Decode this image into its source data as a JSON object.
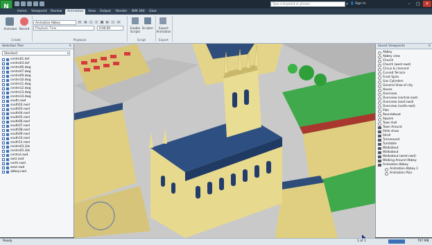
{
  "app": {
    "logo_letter": "N"
  },
  "search": {
    "placeholder": "Type a keyword or phrase"
  },
  "account": {
    "signin": "Sign In"
  },
  "tabs": [
    {
      "label": "Home"
    },
    {
      "label": "Viewpoint"
    },
    {
      "label": "Review"
    },
    {
      "label": "Animation"
    },
    {
      "label": "View"
    },
    {
      "label": "Output"
    },
    {
      "label": "Render"
    },
    {
      "label": "BIM 360"
    },
    {
      "label": "Glue"
    }
  ],
  "ribbon": {
    "create": {
      "animator_label": "Animator",
      "record_label": "Record",
      "group": "Create"
    },
    "playback": {
      "animation_select": "Animation-Abbey",
      "time_value": "0:00.00",
      "playback_time_field": "Playback Time",
      "group": "Playback"
    },
    "script": {
      "enable_label": "Enable Scripts",
      "scripter_label": "Scripter",
      "group": "Script"
    },
    "export": {
      "export_label": "Export Animation",
      "group": "Export"
    }
  },
  "selection_tree": {
    "title": "Selection Tree",
    "dropdown": "Standard",
    "items": [
      "centre01.dxf",
      "centre03.dxf",
      "centre06.dwg",
      "centre07.dwg",
      "centre09.dwg",
      "centre10.dwg",
      "centre11.dwg",
      "centre12.dwg",
      "centre13.dwg",
      "centre14.dwg",
      "south.nwd",
      "south02.nwd",
      "south03.nwd",
      "south04.nwd",
      "south05.nwd",
      "south06.nwd",
      "south07.nwd",
      "south08.nwd",
      "south09.nwd",
      "south10.nwd",
      "south12.nwd",
      "centre03.3ds",
      "centre05.3ds",
      "central.nwd",
      "east.nwd",
      "north.nwd",
      "west.nwd",
      "abbey.nwd"
    ]
  },
  "saved_viewpoints": {
    "title": "Saved Viewpoints",
    "items": [
      {
        "label": "Abbey",
        "kind": "vp"
      },
      {
        "label": "Abbey view",
        "kind": "vp"
      },
      {
        "label": "Church",
        "kind": "vp"
      },
      {
        "label": "Church (west.nwd)",
        "kind": "vp"
      },
      {
        "label": "Circus & crescent",
        "kind": "vp"
      },
      {
        "label": "Curved Terrace",
        "kind": "vp"
      },
      {
        "label": "Front Spire",
        "kind": "vp"
      },
      {
        "label": "Gas Cylinders",
        "kind": "vp"
      },
      {
        "label": "General View of city",
        "kind": "vp"
      },
      {
        "label": "House",
        "kind": "vp"
      },
      {
        "label": "Overview",
        "kind": "vp"
      },
      {
        "label": "Overview (central.nwd)",
        "kind": "vp"
      },
      {
        "label": "Overview (east.nwd)",
        "kind": "vp"
      },
      {
        "label": "Overview (north.nwd)",
        "kind": "vp"
      },
      {
        "label": "Plan",
        "kind": "vp"
      },
      {
        "label": "Roundabout",
        "kind": "vp"
      },
      {
        "label": "Square",
        "kind": "vp"
      },
      {
        "label": "Town Hall",
        "kind": "vp"
      },
      {
        "label": "Town Around",
        "kind": "anim"
      },
      {
        "label": "Slide show",
        "kind": "anim"
      },
      {
        "label": "Stroll",
        "kind": "anim"
      },
      {
        "label": "Turnaround",
        "kind": "anim"
      },
      {
        "label": "Turntable",
        "kind": "anim"
      },
      {
        "label": "Walkabout",
        "kind": "anim"
      },
      {
        "label": "Walkabout",
        "kind": "anim"
      },
      {
        "label": "Walkabout (west.nwd)",
        "kind": "anim"
      },
      {
        "label": "Walking Around Abbey",
        "kind": "anim"
      },
      {
        "label": "Animation-Abbey",
        "kind": "anim"
      },
      {
        "label": "Animation-Abbey 1",
        "kind": "sub"
      },
      {
        "label": "Animation Plan",
        "kind": "sub"
      }
    ]
  },
  "status": {
    "ready": "Ready",
    "page": "1 of 1",
    "memory": "707 MB"
  },
  "colors": {
    "accent": "#2e9d3f",
    "titlebar": "#1e2a36",
    "ribbon": "#e9eef3"
  }
}
